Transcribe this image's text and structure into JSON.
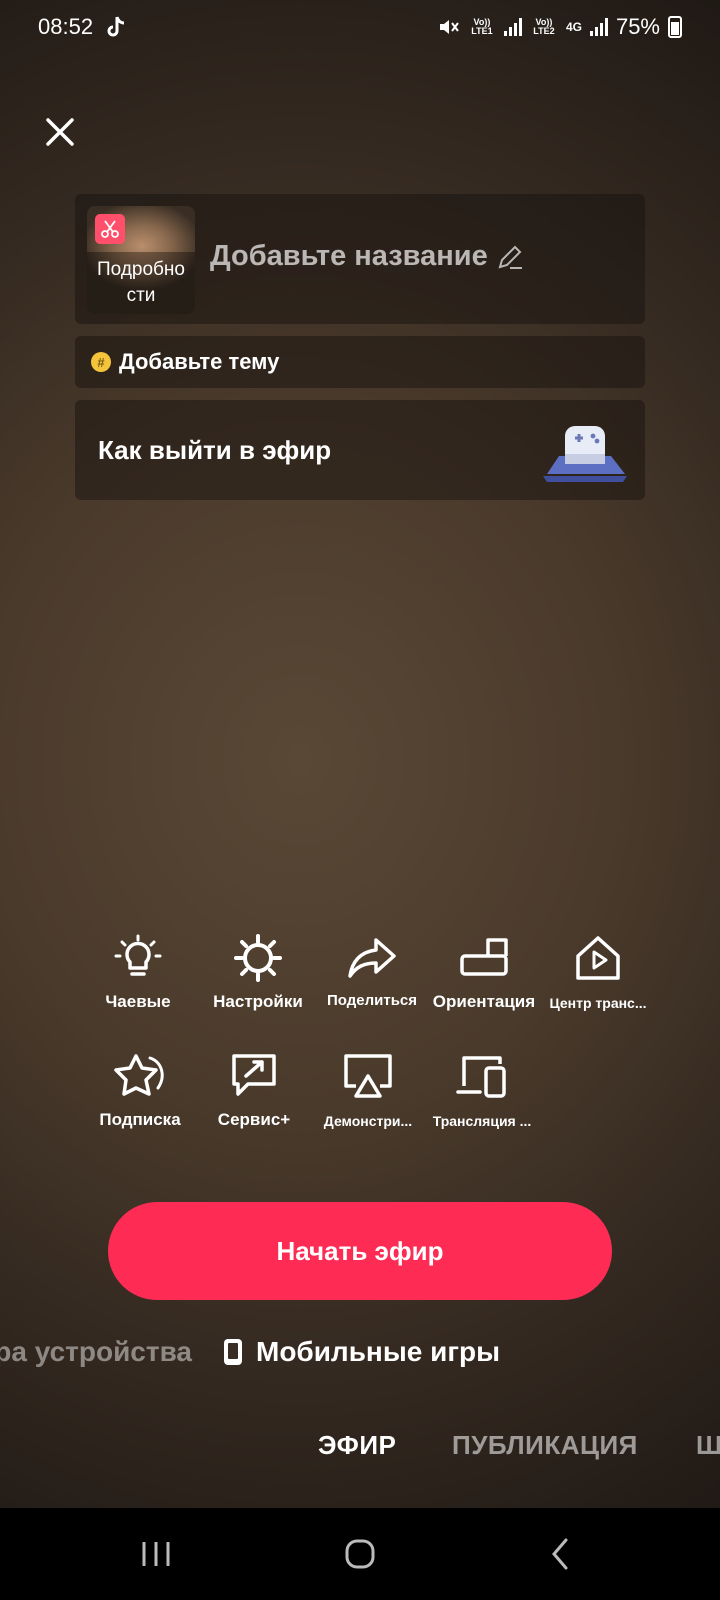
{
  "status": {
    "time": "08:52",
    "sim1": "Vo)) LTE1",
    "sim2": "Vo)) LTE2",
    "net": "4G",
    "battery": "75%"
  },
  "title_card": {
    "thumb_label": "Подробно сти",
    "title_placeholder": "Добавьте название"
  },
  "topic": {
    "label": "Добавьте тему"
  },
  "golive": {
    "label": "Как выйти в эфир"
  },
  "tools": [
    {
      "label": "Чаевые",
      "icon": "lightbulb-icon"
    },
    {
      "label": "Настройки",
      "icon": "gear-icon"
    },
    {
      "label": "Поделиться",
      "icon": "share-icon"
    },
    {
      "label": "Ориентация",
      "icon": "orientation-icon"
    },
    {
      "label": "Центр транс...",
      "icon": "broadcast-center-icon"
    },
    {
      "label": "Подписка",
      "icon": "subscription-star-icon"
    },
    {
      "label": "Сервис+",
      "icon": "service-plus-icon"
    },
    {
      "label": "Демонстри...",
      "icon": "screen-cast-icon"
    },
    {
      "label": "Трансляция ...",
      "icon": "multi-device-icon"
    }
  ],
  "start_button": {
    "label": "Начать эфир"
  },
  "modes": {
    "previous": "ра устройства",
    "current": "Мобильные игры"
  },
  "tabs": [
    "ЭФИР",
    "ПУБЛИКАЦИЯ",
    "Ш"
  ],
  "colors": {
    "accent": "#fe2c55",
    "badge": "#ff4f6a",
    "topic": "#f4c43b"
  }
}
